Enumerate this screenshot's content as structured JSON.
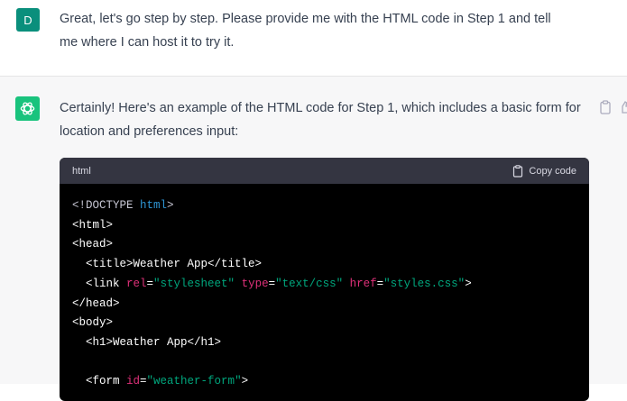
{
  "user": {
    "avatar_letter": "D",
    "message": "Great, let's go step by step. Please provide me with the HTML code in Step 1 and tell me where I can host it to try it."
  },
  "assistant": {
    "message": "Certainly! Here's an example of the HTML code for Step 1, which includes a basic form for location and preferences input:"
  },
  "code_block": {
    "language": "html",
    "copy_label": "Copy code",
    "lines": [
      [
        {
          "t": "<!DOCTYPE ",
          "c": "decl"
        },
        {
          "t": "html",
          "c": "kw"
        },
        {
          "t": ">",
          "c": "decl"
        }
      ],
      [
        {
          "t": "<html>"
        }
      ],
      [
        {
          "t": "<head>"
        }
      ],
      [
        {
          "t": "  <title>Weather App</title>"
        }
      ],
      [
        {
          "t": "  <link "
        },
        {
          "t": "rel",
          "c": "attr"
        },
        {
          "t": "="
        },
        {
          "t": "\"stylesheet\"",
          "c": "str"
        },
        {
          "t": " "
        },
        {
          "t": "type",
          "c": "attr"
        },
        {
          "t": "="
        },
        {
          "t": "\"text/css\"",
          "c": "str"
        },
        {
          "t": " "
        },
        {
          "t": "href",
          "c": "attr"
        },
        {
          "t": "="
        },
        {
          "t": "\"styles.css\"",
          "c": "str"
        },
        {
          "t": ">"
        }
      ],
      [
        {
          "t": "</head>"
        }
      ],
      [
        {
          "t": "<body>"
        }
      ],
      [
        {
          "t": "  <h1>Weather App</h1>"
        }
      ],
      [
        {
          "t": ""
        }
      ],
      [
        {
          "t": "  <form "
        },
        {
          "t": "id",
          "c": "attr"
        },
        {
          "t": "="
        },
        {
          "t": "\"weather-form\"",
          "c": "str"
        },
        {
          "t": ">"
        }
      ]
    ]
  },
  "colors": {
    "user_avatar_bg": "#0a8f7c",
    "bot_avatar_bg": "#19c37d",
    "code_bg": "#000000",
    "code_header_bg": "#343541"
  },
  "icons": [
    "openai-logo-icon",
    "clipboard-icon",
    "thumbs-up-icon"
  ]
}
